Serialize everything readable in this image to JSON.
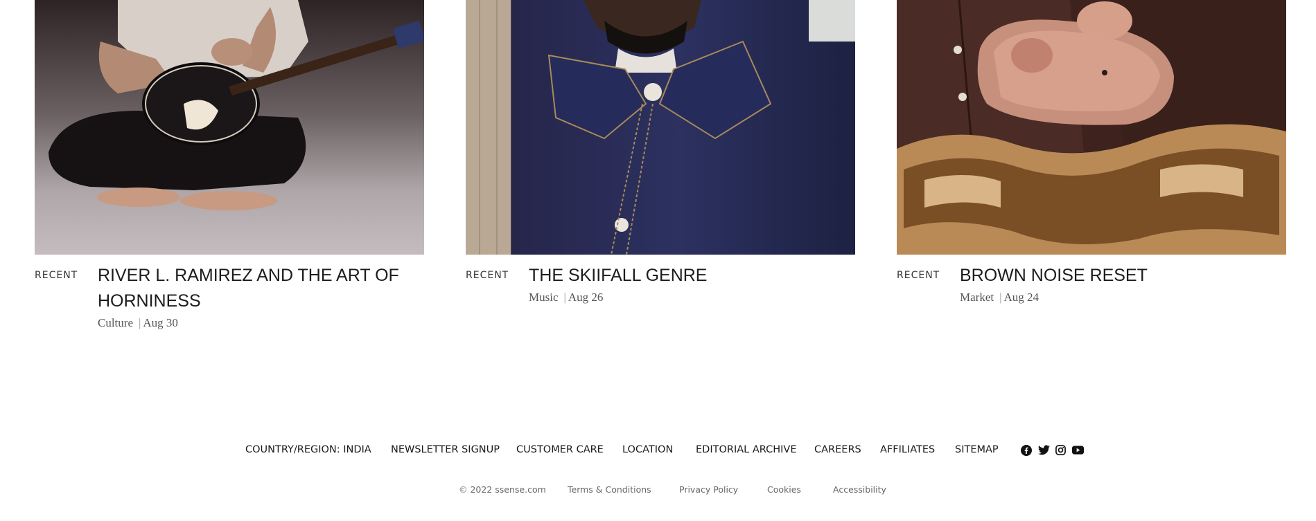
{
  "cards": [
    {
      "tag": "RECENT",
      "title": "RIVER L. RAMIREZ AND THE ART OF HORNINESS",
      "category": "Culture",
      "separator": "|",
      "date": "Aug 30"
    },
    {
      "tag": "RECENT",
      "title": "THE SKIIFALL GENRE",
      "category": "Music",
      "separator": "|",
      "date": "Aug 26"
    },
    {
      "tag": "RECENT",
      "title": "BROWN NOISE RESET",
      "category": "Market",
      "separator": "|",
      "date": "Aug 24"
    }
  ],
  "footer": {
    "links": [
      "COUNTRY/REGION: INDIA",
      "NEWSLETTER SIGNUP",
      "CUSTOMER CARE",
      "LOCATION",
      "EDITORIAL ARCHIVE",
      "CAREERS",
      "AFFILIATES",
      "SITEMAP"
    ],
    "social_icons": [
      "facebook-icon",
      "twitter-icon",
      "instagram-icon",
      "youtube-icon"
    ],
    "copyright": "© 2022 ssense.com",
    "legal": [
      "Terms & Conditions",
      "Privacy Policy",
      "Cookies",
      "Accessibility"
    ]
  }
}
